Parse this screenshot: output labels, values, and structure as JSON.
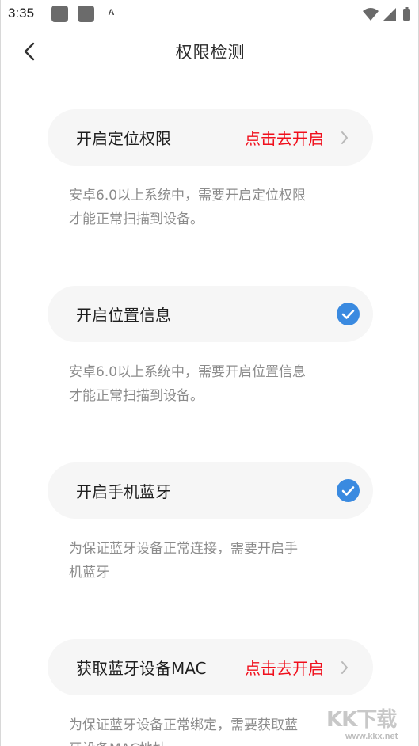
{
  "status_bar": {
    "time": "3:35",
    "badge_letter": "A"
  },
  "header": {
    "title": "权限检测",
    "back_icon": "chevron-left-icon"
  },
  "items": [
    {
      "label": "开启定位权限",
      "action": "点击去开启",
      "state": "off",
      "description": "安卓6.0以上系统中，需要开启定位权限\n才能正常扫描到设备。"
    },
    {
      "label": "开启位置信息",
      "action": "",
      "state": "on",
      "description": "安卓6.0以上系统中，需要开启位置信息\n才能正常扫描到设备。"
    },
    {
      "label": "开启手机蓝牙",
      "action": "",
      "state": "on",
      "description": "为保证蓝牙设备正常连接，需要开启手\n机蓝牙"
    },
    {
      "label": "获取蓝牙设备MAC",
      "action": "点击去开启",
      "state": "off",
      "description": "为保证蓝牙设备正常绑定，需要获取蓝\n牙设备MAC地址"
    }
  ],
  "colors": {
    "action_red": "#f00f1c",
    "check_blue": "#3a8ae0",
    "row_bg": "#f6f6f6",
    "desc_gray": "#8c8c8c"
  },
  "watermark": {
    "main": "KK下载",
    "sub": "www.kkx.net"
  }
}
